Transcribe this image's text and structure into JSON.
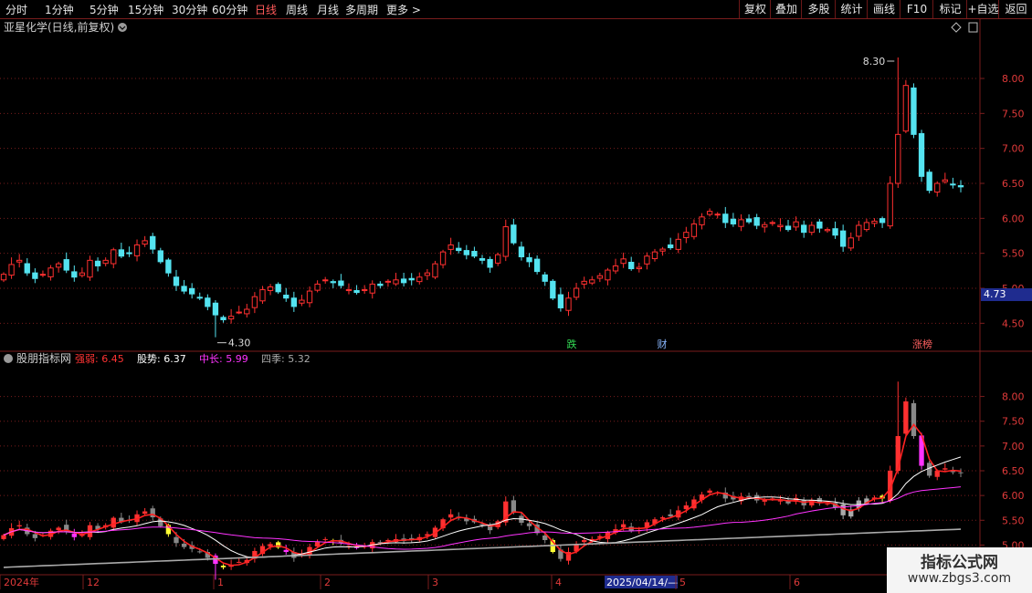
{
  "toolbar": {
    "periods": [
      "分时",
      "1分钟",
      "5分钟",
      "15分钟",
      "30分钟",
      "60分钟",
      "日线",
      "周线",
      "月线",
      "多周期",
      "更多 >"
    ],
    "active_period": "日线",
    "buttons": [
      "复权",
      "叠加",
      "多股",
      "统计",
      "画线",
      "F10",
      "标记",
      "+自选",
      "返回"
    ]
  },
  "main_chart": {
    "title": "亚星化学(日线,前复权)",
    "high_label": "8.30",
    "low_label": "4.30",
    "current_price": "4.73",
    "event_tags": [
      {
        "label": "跌",
        "color": "#33dd55"
      },
      {
        "label": "财",
        "color": "#8ab8ff"
      },
      {
        "label": "涨榜",
        "color": "#ff6060"
      }
    ]
  },
  "indicator": {
    "name": "股朋指标网",
    "items": [
      {
        "label": "强弱:",
        "value": "6.45",
        "color": "#ff3333"
      },
      {
        "label": "股势:",
        "value": "6.37",
        "color": "#ffffff"
      },
      {
        "label": "中长:",
        "value": "5.99",
        "color": "#ff33ff"
      },
      {
        "label": "四季:",
        "value": "5.32",
        "color": "#aaaaaa"
      }
    ]
  },
  "date_axis": [
    "2024年",
    "12",
    "1",
    "2",
    "3",
    "4",
    "2025/04/14/—",
    "5",
    "6"
  ],
  "watermark": {
    "line1": "指标公式网",
    "line2": "www.zbgs3.com"
  },
  "chart_data": [
    {
      "type": "candlestick",
      "title": "亚星化学(日线,前复权)",
      "y_ticks": [
        4.5,
        5.0,
        5.5,
        6.0,
        6.5,
        7.0,
        7.5,
        8.0
      ],
      "ylim": [
        4.1,
        8.6
      ],
      "x_ticks": [
        "2024年",
        "12",
        "1",
        "2",
        "3",
        "4",
        "5",
        "6"
      ],
      "high": 8.3,
      "low": 4.3,
      "close_values": [
        5.2,
        5.34,
        5.4,
        5.22,
        5.14,
        5.2,
        5.29,
        5.35,
        5.26,
        5.16,
        5.22,
        5.4,
        5.32,
        5.4,
        5.55,
        5.46,
        5.5,
        5.62,
        5.68,
        5.56,
        5.38,
        5.22,
        5.04,
        4.96,
        4.92,
        4.86,
        4.74,
        4.62,
        4.55,
        4.6,
        4.66,
        4.7,
        4.88,
        4.98,
        5.02,
        4.95,
        4.86,
        4.74,
        4.83,
        4.96,
        5.06,
        5.12,
        5.08,
        5.04,
        4.98,
        4.94,
        4.98,
        5.06,
        5.04,
        5.1,
        5.12,
        5.08,
        5.12,
        5.16,
        5.22,
        5.35,
        5.52,
        5.62,
        5.54,
        5.48,
        5.46,
        5.4,
        5.3,
        5.48,
        5.88,
        5.65,
        5.45,
        5.38,
        5.24,
        5.1,
        4.86,
        4.72,
        4.86,
        5.0,
        5.1,
        5.12,
        5.18,
        5.26,
        5.32,
        5.42,
        5.28,
        5.3,
        5.46,
        5.52,
        5.56,
        5.58,
        5.7,
        5.8,
        5.92,
        6.02,
        6.1,
        6.06,
        5.94,
        5.92,
        5.98,
        5.95,
        5.9,
        5.91,
        5.94,
        5.9,
        5.84,
        5.95,
        5.8,
        5.9,
        5.86,
        5.84,
        5.76,
        5.6,
        5.72,
        5.9,
        5.94,
        5.96,
        5.94,
        6.5,
        7.2,
        7.9,
        7.2,
        6.6,
        6.4,
        6.5,
        6.55,
        6.48,
        6.45
      ]
    },
    {
      "type": "line",
      "title": "股朋指标网",
      "y_ticks": [
        5.0,
        5.5,
        6.0,
        6.5,
        7.0,
        7.5,
        8.0
      ],
      "ylim": [
        4.4,
        8.6
      ],
      "series": [
        {
          "name": "强弱",
          "last": 6.45,
          "color": "#ff2222"
        },
        {
          "name": "股势",
          "last": 6.37,
          "color": "#ffffff"
        },
        {
          "name": "中长",
          "last": 5.99,
          "color": "#ff33ff"
        },
        {
          "name": "四季",
          "last": 5.32,
          "color": "#aaaaaa"
        }
      ]
    }
  ],
  "colors": {
    "up": "#ff3030",
    "down": "#54e3f0",
    "grid": "#7a1d1d",
    "axis_text": "#e03a3a"
  }
}
